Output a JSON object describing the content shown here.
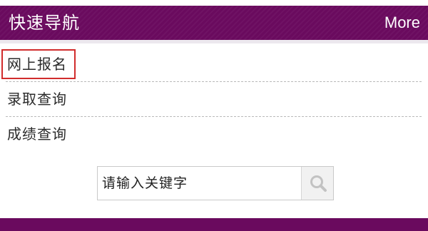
{
  "header": {
    "title": "快速导航",
    "more_label": "More"
  },
  "nav": {
    "items": [
      {
        "label": "网上报名",
        "highlighted": true
      },
      {
        "label": "录取查询",
        "highlighted": false
      },
      {
        "label": "成绩查询",
        "highlighted": false
      }
    ]
  },
  "search": {
    "placeholder": "请输入关键字",
    "value": "",
    "button_icon": "search-icon"
  },
  "colors": {
    "brand_purple": "#6a0a5e",
    "highlight_red": "#d12c2c",
    "divider_gray": "#b9b9b9",
    "search_button_bg": "#f1f1f1"
  }
}
